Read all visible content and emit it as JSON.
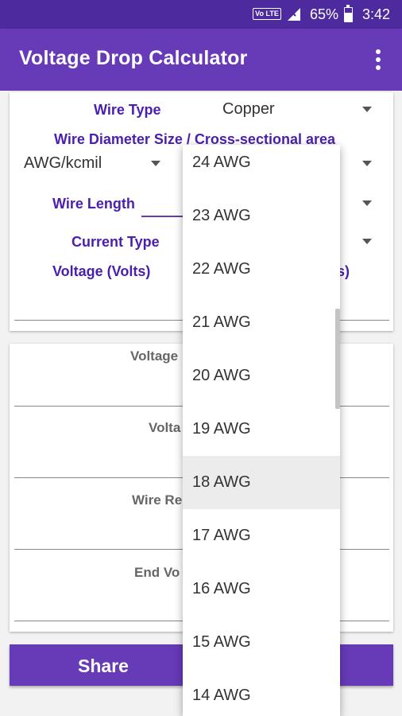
{
  "status_bar": {
    "volte": "Vo LTE",
    "battery_percent": "65%",
    "battery_level": 0.65,
    "time": "3:42"
  },
  "app_bar": {
    "title": "Voltage Drop Calculator",
    "overflow_icon": "more-vert-icon"
  },
  "form": {
    "wire_type_label": "Wire Type",
    "wire_type_value": "Copper",
    "wire_diameter_label": "Wire Diameter Size / Cross-sectional area",
    "wire_size_unit": "AWG/kcmil",
    "wire_length_label": "Wire Length",
    "current_type_label": "Current Type",
    "voltage_label": "Voltage (Volts)",
    "right_partial_label": "s)"
  },
  "results": {
    "labels": [
      "Voltage",
      "Volta",
      "Wire Re",
      "End Vo"
    ]
  },
  "share_button": {
    "label": "Share"
  },
  "dropdown": {
    "items": [
      "24 AWG",
      "23 AWG",
      "22 AWG",
      "21 AWG",
      "20 AWG",
      "19 AWG",
      "18 AWG",
      "17 AWG",
      "16 AWG",
      "15 AWG",
      "14 AWG"
    ],
    "selected": "18 AWG"
  },
  "colors": {
    "primary": "#673ab7",
    "primary_dark": "#4e2a9f",
    "label_purple": "#4a1fb0"
  }
}
